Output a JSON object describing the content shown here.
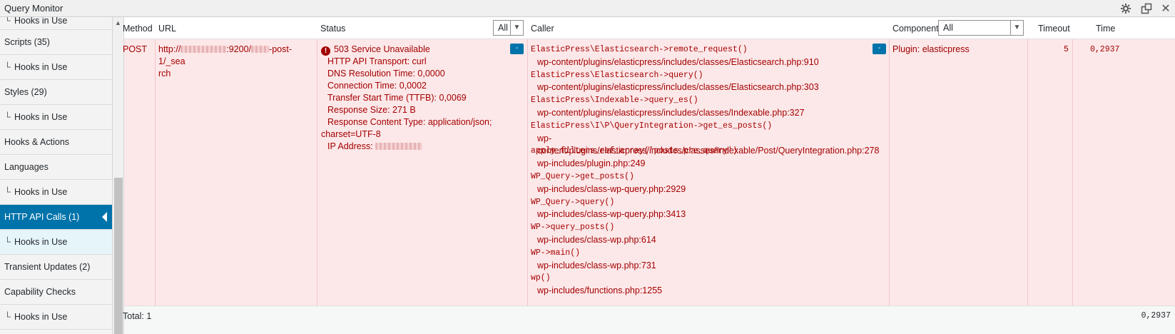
{
  "window": {
    "title": "Query Monitor"
  },
  "sidebar": {
    "items": [
      {
        "label": "Hooks in Use",
        "sub": true
      },
      {
        "label": "Scripts (35)",
        "sub": false
      },
      {
        "label": "Hooks in Use",
        "sub": true
      },
      {
        "label": "Styles (29)",
        "sub": false
      },
      {
        "label": "Hooks in Use",
        "sub": true
      },
      {
        "label": "Hooks & Actions",
        "sub": false
      },
      {
        "label": "Languages",
        "sub": false
      },
      {
        "label": "Hooks in Use",
        "sub": true
      },
      {
        "label": "HTTP API Calls (1)",
        "sub": false,
        "active": true
      },
      {
        "label": "Hooks in Use",
        "sub": true
      },
      {
        "label": "Transient Updates (2)",
        "sub": false
      },
      {
        "label": "Capability Checks",
        "sub": false
      },
      {
        "label": "Hooks in Use",
        "sub": true
      }
    ],
    "sub_glyph": "└"
  },
  "table": {
    "headers": {
      "method": "Method",
      "url": "URL",
      "status": "Status",
      "status_filter": "All",
      "caller": "Caller",
      "component": "Component",
      "component_filter": "All",
      "timeout": "Timeout",
      "time": "Time"
    },
    "row": {
      "method": "POST",
      "url_prefix": "http://",
      "url_port": ":9200/",
      "url_suffix": "-post-1/_sea",
      "url_suffix_2": "rch",
      "status_title": "503 Service Unavailable",
      "status_lines": [
        "HTTP API Transport: curl",
        "DNS Resolution Time: 0,0000",
        "Connection Time: 0,0002",
        "Transfer Start Time (TTFB): 0,0069",
        "Response Size: 271 B",
        "Response Content Type: application/json;"
      ],
      "status_wrap": "charset=UTF-8",
      "status_ip_label": "IP Address:",
      "toggle_label": "-",
      "callers": [
        {
          "fn": "ElasticPress\\Elasticsearch->remote_request()",
          "file": "wp-content/plugins/elasticpress/includes/classes/Elasticsearch.php:910"
        },
        {
          "fn": "ElasticPress\\Elasticsearch->query()",
          "file": "wp-content/plugins/elasticpress/includes/classes/Elasticsearch.php:303"
        },
        {
          "fn": "ElasticPress\\Indexable->query_es()",
          "file": "wp-content/plugins/elasticpress/includes/classes/Indexable.php:327"
        },
        {
          "fn": "ElasticPress\\I\\P\\QueryIntegration->get_es_posts()",
          "file": "wp-content/plugins/elasticpress/includes/classes/Indexable/Post/QueryIntegration.php:278"
        },
        {
          "fn": "apply_filters_ref_array('posts_pre_query')",
          "file": "wp-includes/plugin.php:249"
        },
        {
          "fn": "WP_Query->get_posts()",
          "file": "wp-includes/class-wp-query.php:2929"
        },
        {
          "fn": "WP_Query->query()",
          "file": "wp-includes/class-wp-query.php:3413"
        },
        {
          "fn": "WP->query_posts()",
          "file": "wp-includes/class-wp.php:614"
        },
        {
          "fn": "WP->main()",
          "file": "wp-includes/class-wp.php:731"
        },
        {
          "fn": "wp()",
          "file": "wp-includes/functions.php:1255"
        }
      ],
      "component": "Plugin: elasticpress",
      "timeout": "5",
      "time": "0,2937"
    },
    "footer": {
      "total": "Total: 1",
      "time": "0,2937"
    }
  },
  "colors": {
    "accent": "#0073aa",
    "error_text": "#a30000",
    "error_row_bg": "#fde8e9"
  }
}
